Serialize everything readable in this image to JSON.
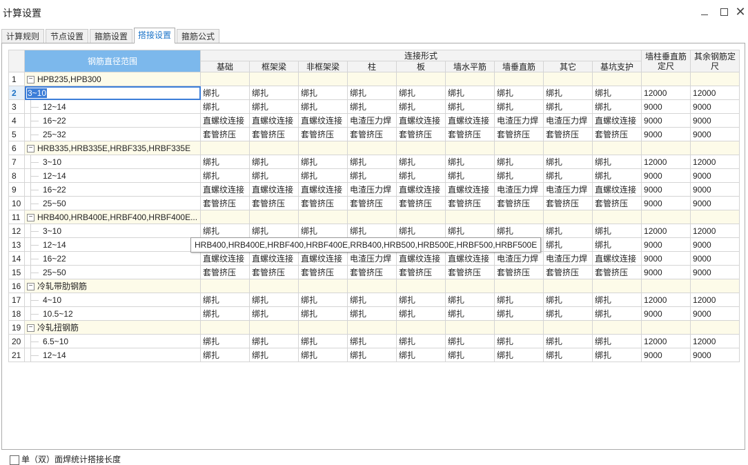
{
  "window": {
    "title": "计算设置"
  },
  "tabs": [
    {
      "label": "计算规则",
      "active": false
    },
    {
      "label": "节点设置",
      "active": false
    },
    {
      "label": "箍筋设置",
      "active": false
    },
    {
      "label": "搭接设置",
      "active": true
    },
    {
      "label": "箍筋公式",
      "active": false
    }
  ],
  "table": {
    "range_header": "钢筋直径范围",
    "conn_header": "连接形式",
    "conn_columns": [
      "基础",
      "框架梁",
      "非框架梁",
      "柱",
      "板",
      "墙水平筋",
      "墙垂直筋",
      "其它",
      "基坑支护"
    ],
    "wall_len_header": "墙柱垂直筋定尺",
    "other_len_header": "其余钢筋定尺",
    "rows": [
      {
        "num": "1",
        "group": true,
        "label": "HPB235,HPB300"
      },
      {
        "num": "2",
        "group": false,
        "label": "3~10",
        "cells": [
          "绑扎",
          "绑扎",
          "绑扎",
          "绑扎",
          "绑扎",
          "绑扎",
          "绑扎",
          "绑扎",
          "绑扎"
        ],
        "wall": "12000",
        "other": "12000"
      },
      {
        "num": "3",
        "group": false,
        "label": "12~14",
        "cells": [
          "绑扎",
          "绑扎",
          "绑扎",
          "绑扎",
          "绑扎",
          "绑扎",
          "绑扎",
          "绑扎",
          "绑扎"
        ],
        "wall": "9000",
        "other": "9000"
      },
      {
        "num": "4",
        "group": false,
        "label": "16~22",
        "cells": [
          "直螺纹连接",
          "直螺纹连接",
          "直螺纹连接",
          "电渣压力焊",
          "直螺纹连接",
          "直螺纹连接",
          "电渣压力焊",
          "电渣压力焊",
          "直螺纹连接"
        ],
        "wall": "9000",
        "other": "9000"
      },
      {
        "num": "5",
        "group": false,
        "label": "25~32",
        "cells": [
          "套管挤压",
          "套管挤压",
          "套管挤压",
          "套管挤压",
          "套管挤压",
          "套管挤压",
          "套管挤压",
          "套管挤压",
          "套管挤压"
        ],
        "wall": "9000",
        "other": "9000"
      },
      {
        "num": "6",
        "group": true,
        "label": "HRB335,HRB335E,HRBF335,HRBF335E"
      },
      {
        "num": "7",
        "group": false,
        "label": "3~10",
        "cells": [
          "绑扎",
          "绑扎",
          "绑扎",
          "绑扎",
          "绑扎",
          "绑扎",
          "绑扎",
          "绑扎",
          "绑扎"
        ],
        "wall": "12000",
        "other": "12000"
      },
      {
        "num": "8",
        "group": false,
        "label": "12~14",
        "cells": [
          "绑扎",
          "绑扎",
          "绑扎",
          "绑扎",
          "绑扎",
          "绑扎",
          "绑扎",
          "绑扎",
          "绑扎"
        ],
        "wall": "9000",
        "other": "9000"
      },
      {
        "num": "9",
        "group": false,
        "label": "16~22",
        "cells": [
          "直螺纹连接",
          "直螺纹连接",
          "直螺纹连接",
          "电渣压力焊",
          "直螺纹连接",
          "直螺纹连接",
          "电渣压力焊",
          "电渣压力焊",
          "直螺纹连接"
        ],
        "wall": "9000",
        "other": "9000"
      },
      {
        "num": "10",
        "group": false,
        "label": "25~50",
        "cells": [
          "套管挤压",
          "套管挤压",
          "套管挤压",
          "套管挤压",
          "套管挤压",
          "套管挤压",
          "套管挤压",
          "套管挤压",
          "套管挤压"
        ],
        "wall": "9000",
        "other": "9000"
      },
      {
        "num": "11",
        "group": true,
        "label": "HRB400,HRB400E,HRBF400,HRBF400E..."
      },
      {
        "num": "12",
        "group": false,
        "label": "3~10",
        "cells": [
          "绑扎",
          "绑扎",
          "绑扎",
          "绑扎",
          "绑扎",
          "绑扎",
          "绑扎",
          "绑扎",
          "绑扎"
        ],
        "wall": "12000",
        "other": "12000"
      },
      {
        "num": "13",
        "group": false,
        "label": "12~14",
        "cells": [
          "绑扎",
          "绑扎",
          "绑扎",
          "绑扎",
          "绑扎",
          "绑扎",
          "绑扎",
          "绑扎",
          "绑扎"
        ],
        "wall": "9000",
        "other": "9000"
      },
      {
        "num": "14",
        "group": false,
        "label": "16~22",
        "cells": [
          "直螺纹连接",
          "直螺纹连接",
          "直螺纹连接",
          "电渣压力焊",
          "直螺纹连接",
          "直螺纹连接",
          "电渣压力焊",
          "电渣压力焊",
          "直螺纹连接"
        ],
        "wall": "9000",
        "other": "9000"
      },
      {
        "num": "15",
        "group": false,
        "label": "25~50",
        "cells": [
          "套管挤压",
          "套管挤压",
          "套管挤压",
          "套管挤压",
          "套管挤压",
          "套管挤压",
          "套管挤压",
          "套管挤压",
          "套管挤压"
        ],
        "wall": "9000",
        "other": "9000"
      },
      {
        "num": "16",
        "group": true,
        "label": "冷轧带肋钢筋"
      },
      {
        "num": "17",
        "group": false,
        "label": "4~10",
        "cells": [
          "绑扎",
          "绑扎",
          "绑扎",
          "绑扎",
          "绑扎",
          "绑扎",
          "绑扎",
          "绑扎",
          "绑扎"
        ],
        "wall": "12000",
        "other": "12000"
      },
      {
        "num": "18",
        "group": false,
        "label": "10.5~12",
        "cells": [
          "绑扎",
          "绑扎",
          "绑扎",
          "绑扎",
          "绑扎",
          "绑扎",
          "绑扎",
          "绑扎",
          "绑扎"
        ],
        "wall": "9000",
        "other": "9000"
      },
      {
        "num": "19",
        "group": true,
        "label": "冷轧扭钢筋"
      },
      {
        "num": "20",
        "group": false,
        "label": "6.5~10",
        "cells": [
          "绑扎",
          "绑扎",
          "绑扎",
          "绑扎",
          "绑扎",
          "绑扎",
          "绑扎",
          "绑扎",
          "绑扎"
        ],
        "wall": "12000",
        "other": "12000"
      },
      {
        "num": "21",
        "group": false,
        "label": "12~14",
        "cells": [
          "绑扎",
          "绑扎",
          "绑扎",
          "绑扎",
          "绑扎",
          "绑扎",
          "绑扎",
          "绑扎",
          "绑扎"
        ],
        "wall": "9000",
        "other": "9000"
      }
    ]
  },
  "tooltip": {
    "text": "HRB400,HRB400E,HRBF400,HRBF400E,RRB400,HRB500,HRB500E,HRBF500,HRBF500E"
  },
  "footer": {
    "checkbox_label": "单（双）面焊统计搭接长度"
  }
}
